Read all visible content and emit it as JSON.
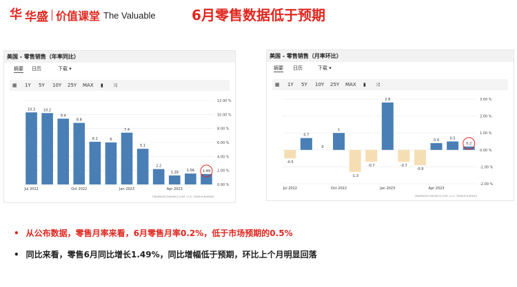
{
  "header": {
    "logo_mark": "华",
    "logo_cn1": "华盛",
    "logo_cn2": "价值课堂",
    "logo_en": "The Valuable",
    "title": "6月零售数据低于预期"
  },
  "left_panel": {
    "title": "美国 - 零售销售（年率同比）",
    "tabs": [
      "摘要",
      "日历",
      "下载"
    ],
    "toolbar": [
      "1Y",
      "5Y",
      "10Y",
      "25Y",
      "MAX"
    ],
    "footer": "TRADINGECONOMICS.COM  |  U.S. CENSUS BUREAU"
  },
  "right_panel": {
    "title": "美国 - 零售销售（月率环比）",
    "tabs": [
      "摘要",
      "日历",
      "下载"
    ],
    "toolbar": [
      "1Y",
      "5Y",
      "10Y",
      "25Y",
      "MAX"
    ],
    "footer": "TRADINGECONOMICS.COM  |  U.S. CENSUS BUREAU"
  },
  "chart_data": [
    {
      "type": "bar",
      "categories": [
        "Jul 2022",
        "Aug 2022",
        "Sep 2022",
        "Oct 2022",
        "Nov 2022",
        "Dec 2022",
        "Jan 2023",
        "Feb 2023",
        "Mar 2023",
        "Apr 2023",
        "May 2023",
        "Jun 2023"
      ],
      "values": [
        10.3,
        10.2,
        9.4,
        8.8,
        6.1,
        6.0,
        7.4,
        5.1,
        2.2,
        1.29,
        1.56,
        1.49
      ],
      "data_labels": [
        "10.3",
        "10.2",
        "9.4",
        "8.8",
        "6.1",
        "6",
        "7.4",
        "5.1",
        "2.2",
        "1.29",
        "1.56",
        "1.49"
      ],
      "x_tick_labels": [
        "Jul 2022",
        "Oct 2022",
        "Jan 2023",
        "Apr 2023"
      ],
      "y_tick_labels": [
        "12.00 %",
        "10.00 %",
        "8.00 %",
        "6.00 %",
        "4.00 %",
        "2.00 %",
        "0.00 %"
      ],
      "ylim": [
        0,
        12
      ],
      "highlight_index": 11,
      "bar_color": "#4a7fb5",
      "grid": true
    },
    {
      "type": "bar",
      "categories": [
        "Jul 2022",
        "Aug 2022",
        "Sep 2022",
        "Oct 2022",
        "Nov 2022",
        "Dec 2022",
        "Jan 2023",
        "Feb 2023",
        "Mar 2023",
        "Apr 2023",
        "May 2023",
        "Jun 2023"
      ],
      "values": [
        -0.5,
        0.7,
        0,
        1,
        -1.3,
        -0.7,
        2.8,
        -0.7,
        -0.9,
        0.4,
        0.5,
        0.2
      ],
      "data_labels": [
        "-0.5",
        "0.7",
        "0",
        "1",
        "-1.3",
        "-0.7",
        "2.8",
        "-0.7",
        "-0.9",
        "0.4",
        "0.5",
        "0.2"
      ],
      "x_tick_labels": [
        "Jul 2022",
        "Oct 2022",
        "Jan 2023",
        "Apr 2023"
      ],
      "y_tick_labels": [
        "3.00 %",
        "2.00 %",
        "1.00 %",
        "0.00 %",
        "-1.00 %",
        "-2.00 %"
      ],
      "ylim": [
        -2,
        3
      ],
      "highlight_index": 11,
      "positive_color": "#4a7fb5",
      "negative_color": "#f5deb3",
      "grid": true
    }
  ],
  "bullets": [
    {
      "dot": "•",
      "text": "从公布数据，零售月率来看，6月零售月率0.2%，低于市场预期的0.5%",
      "color": "#e0261f"
    },
    {
      "dot": "•",
      "text": "同比来看，零售6月同比增长1.49%，同比增幅低于预期，环比上个月明显回落",
      "color": "#222222"
    }
  ]
}
